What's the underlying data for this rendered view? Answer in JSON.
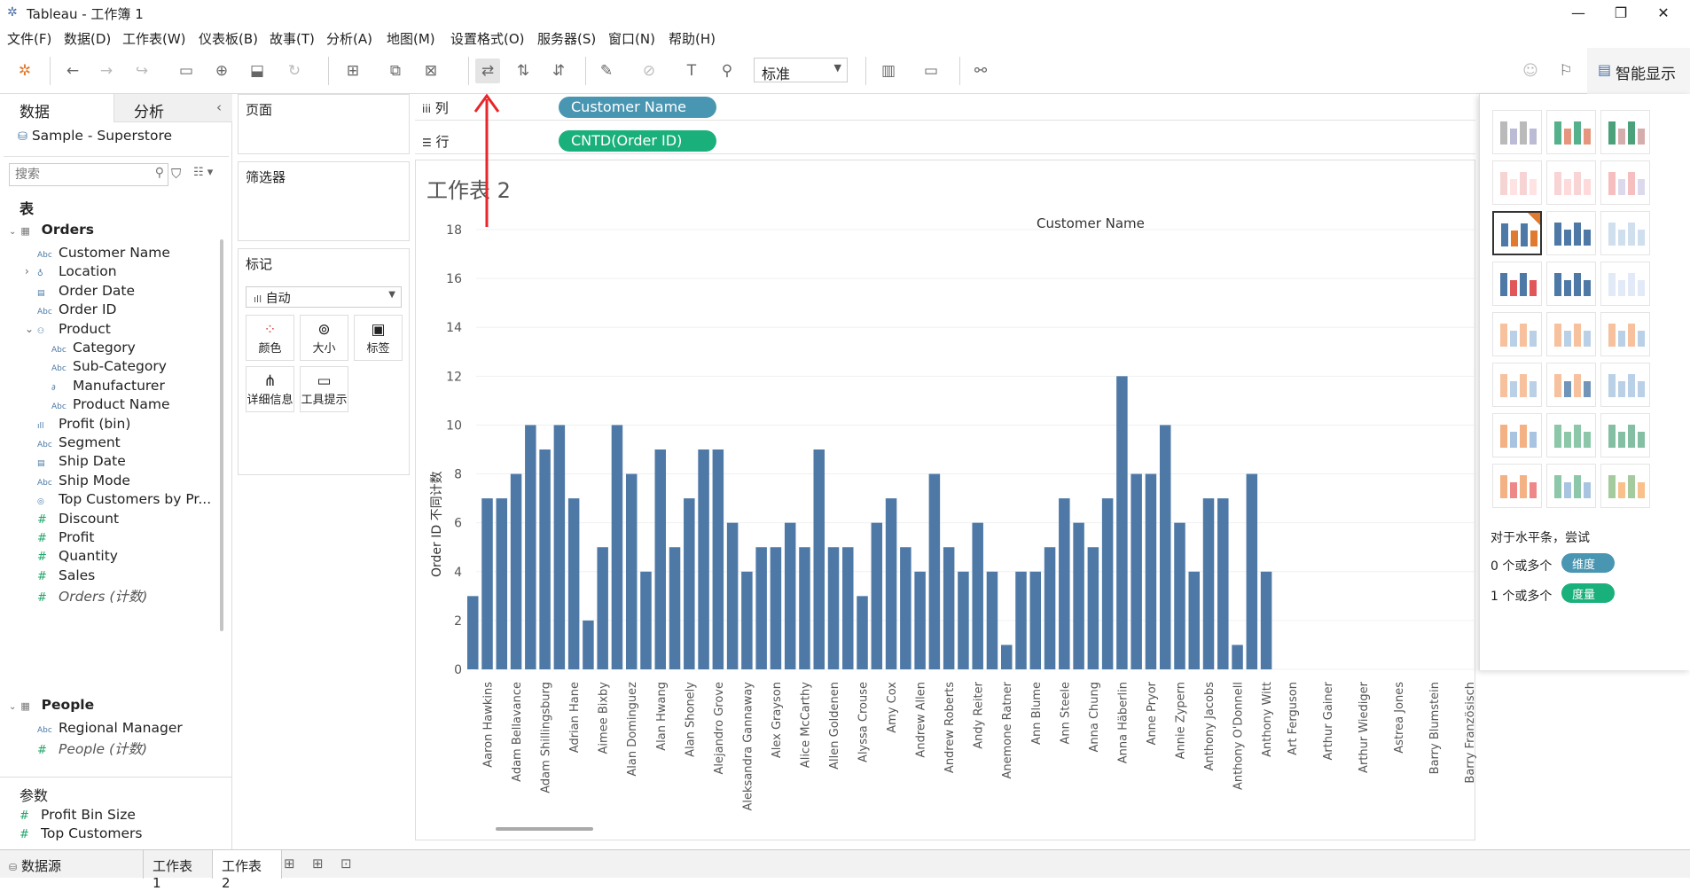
{
  "window": {
    "title": "Tableau - 工作簿 1",
    "min": "—",
    "max": "❐",
    "close": "✕"
  },
  "menu": [
    "文件(F)",
    "数据(D)",
    "工作表(W)",
    "仪表板(B)",
    "故事(T)",
    "分析(A)",
    "地图(M)",
    "设置格式(O)",
    "服务器(S)",
    "窗口(N)",
    "帮助(H)"
  ],
  "toolbar": {
    "fit_value": "标准",
    "smart_label": "智能显示"
  },
  "datapane": {
    "tab_data": "数据",
    "tab_analysis": "分析",
    "datasource": "Sample - Superstore",
    "search_placeholder": "搜索",
    "tables_header": "表",
    "orders": "Orders",
    "fields_orders": [
      {
        "icon": "Abc",
        "name": "Customer Name"
      },
      {
        "icon": "geo",
        "name": "Location"
      },
      {
        "icon": "date",
        "name": "Order Date"
      },
      {
        "icon": "Abc",
        "name": "Order ID"
      },
      {
        "icon": "hier",
        "name": "Product"
      },
      {
        "icon": "Abc",
        "name": "Category"
      },
      {
        "icon": "Abc",
        "name": "Sub-Category"
      },
      {
        "icon": "link",
        "name": "Manufacturer"
      },
      {
        "icon": "Abc",
        "name": "Product Name"
      },
      {
        "icon": "bin",
        "name": "Profit (bin)"
      },
      {
        "icon": "Abc",
        "name": "Segment"
      },
      {
        "icon": "date",
        "name": "Ship Date"
      },
      {
        "icon": "Abc",
        "name": "Ship Mode"
      },
      {
        "icon": "set",
        "name": "Top Customers by Pr..."
      },
      {
        "icon": "#",
        "name": "Discount"
      },
      {
        "icon": "#",
        "name": "Profit"
      },
      {
        "icon": "#",
        "name": "Quantity"
      },
      {
        "icon": "#",
        "name": "Sales"
      },
      {
        "icon": "#",
        "name": "Orders (计数)"
      }
    ],
    "people": "People",
    "fields_people": [
      {
        "icon": "Abc",
        "name": "Regional Manager"
      },
      {
        "icon": "#",
        "name": "People (计数)"
      }
    ],
    "params_header": "参数",
    "params": [
      {
        "icon": "#",
        "name": "Profit Bin Size"
      },
      {
        "icon": "#",
        "name": "Top Customers"
      }
    ]
  },
  "cards": {
    "pages": "页面",
    "filters": "筛选器",
    "marks": "标记",
    "marks_type": "自动",
    "mark_buttons": [
      "颜色",
      "大小",
      "标签",
      "详细信息",
      "工具提示"
    ]
  },
  "shelves": {
    "columns_label": "列",
    "rows_label": "行",
    "columns_pill": "Customer Name",
    "rows_pill": "CNTD(Order ID)"
  },
  "view": {
    "sheet_title": "工作表 2",
    "x_header": "Customer Name",
    "y_axis_title": "Order ID 不同计数"
  },
  "chart_data": {
    "type": "bar",
    "title": "工作表 2",
    "xlabel": "Customer Name",
    "ylabel": "Order ID 不同计数",
    "ylim": [
      0,
      18
    ],
    "yticks": [
      0,
      2,
      4,
      6,
      8,
      10,
      12,
      14,
      16,
      18
    ],
    "categories": [
      "",
      "Aaron Hawkins",
      "",
      "Adam Bellavance",
      "",
      "Adam Shillingsburg",
      "",
      "Adrian Hane",
      "",
      "Aimee Bixby",
      "",
      "Alan Dominguez",
      "",
      "Alan Hwang",
      "",
      "Alan Shonely",
      "",
      "Alejandro Grove",
      "",
      "Aleksandra Gannaway",
      "",
      "Alex Grayson",
      "",
      "Alice McCarthy",
      "",
      "Allen Goldenen",
      "",
      "Alyssa Crouse",
      "",
      "Amy Cox",
      "",
      "Andrew Allen",
      "",
      "Andrew Roberts",
      "",
      "Andy Reiter",
      "",
      "Anemone Ratner",
      "",
      "Ann Blume",
      "",
      "Ann Steele",
      "",
      "Anna Chung",
      "",
      "Anna Häberlin",
      "",
      "Anne Pryor",
      "",
      "Annie Zypern",
      "",
      "Anthony Jacobs",
      "",
      "Anthony O'Donnell",
      "",
      "Anthony Witt"
    ],
    "values": [
      3,
      7,
      7,
      8,
      10,
      9,
      10,
      7,
      2,
      5,
      10,
      8,
      4,
      9,
      5,
      7,
      9,
      9,
      6,
      4,
      5,
      5,
      6,
      5,
      9,
      5,
      5,
      3,
      6,
      7,
      5,
      4,
      8,
      5,
      4,
      6,
      4,
      1,
      4,
      4,
      5,
      7,
      6,
      5,
      7,
      12,
      8,
      8,
      10,
      6,
      4,
      7,
      7,
      1,
      8,
      4
    ],
    "offscreen_tick_labels": [
      "Art Ferguson",
      "Arthur Gainer",
      "Arthur Wiediger",
      "Astrea Jones",
      "Barry Blumstein",
      "Barry Französisch"
    ],
    "bar_color": "#4e79a7"
  },
  "showme": {
    "hint": "对于水平条，尝试",
    "row1_prefix": "0 个或多个",
    "row1_pill": "维度",
    "row2_prefix": "1 个或多个",
    "row2_pill": "度量"
  },
  "tabs": {
    "datasource": "数据源",
    "sheet1": "工作表 1",
    "sheet2": "工作表 2"
  },
  "colors": {
    "dimension_pill": "#4996b2",
    "measure_pill": "#1ab07b",
    "annotation_arrow": "#e8262a"
  }
}
